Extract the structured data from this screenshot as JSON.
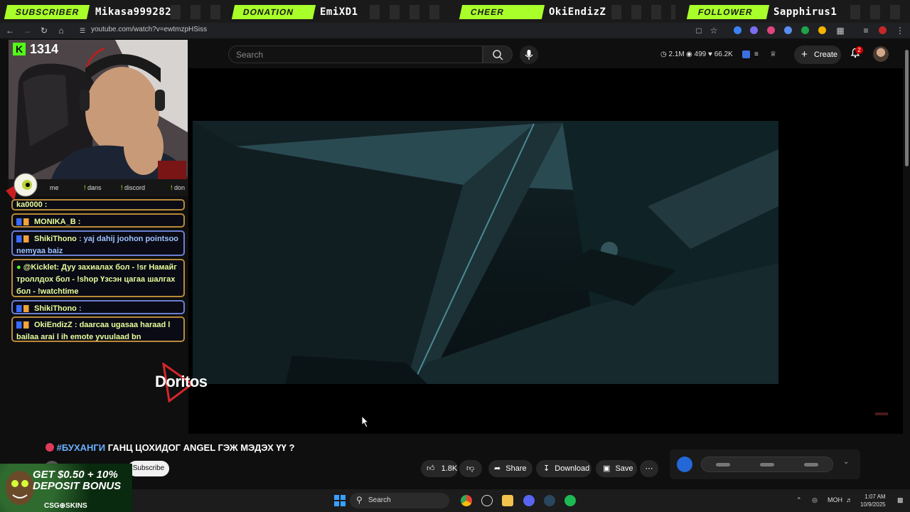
{
  "alerts": [
    {
      "type": "SUBSCRIBER",
      "name": "Mikasa999282"
    },
    {
      "type": "DONATION",
      "name": "EmiXD1"
    },
    {
      "type": "CHEER",
      "name": "OkiEndizZ"
    },
    {
      "type": "FOLLOWER",
      "name": "Sapphirus1"
    }
  ],
  "browser": {
    "url": "youtube.com/watch?v=ewtmzpHSiss"
  },
  "youtube": {
    "search_placeholder": "Search",
    "stats": {
      "views": "2.1M",
      "watching": "499",
      "likes": "66.2K"
    },
    "create_label": "Create",
    "notifications": "2"
  },
  "stream": {
    "points": "1314",
    "commands": [
      "me",
      "dans",
      "discord",
      "don"
    ]
  },
  "chat": [
    {
      "user": "ka0000",
      "text": ""
    },
    {
      "user": "MONIKA_B",
      "text": ""
    },
    {
      "user": "ShikiThono",
      "text": "yaj dahij joohon pointsoo nemyaa baiz"
    },
    {
      "user": "@Kicklet",
      "text": "Дуу захиалах бол - !sr Намайг троллдох бол - !shop Үзсэн цагаа шалгах бол - !watchtime"
    },
    {
      "user": "ShikiThono",
      "text": ""
    },
    {
      "user": "OkiEndizZ",
      "text": "daarcaa ugasaa haraad l bailaa arai l ih emote yvuulaad bn"
    }
  ],
  "sponsor": "Doritos",
  "video": {
    "title_tag": "#БУХАНГИ",
    "title": "ГАНЦ ЦОХИДОГ ANGEL ГЭЖ МЭДЭХ ҮҮ ?",
    "subscribe_label": "Subscribe",
    "like_count": "1.8K",
    "share_label": "Share",
    "download_label": "Download",
    "save_label": "Save"
  },
  "ad": {
    "headline": "GET $0.50 + 10% DEPOSIT BONUS",
    "brand": "CSG⊕SKINS"
  },
  "taskbar": {
    "search_label": "Search",
    "lang": "МОН",
    "time": "1:07 AM",
    "date": "10/9/2025"
  },
  "colors": {
    "alert_green": "#a8ff2a",
    "kick_green": "#53fc18",
    "chat_border": "#6b7fd1"
  }
}
